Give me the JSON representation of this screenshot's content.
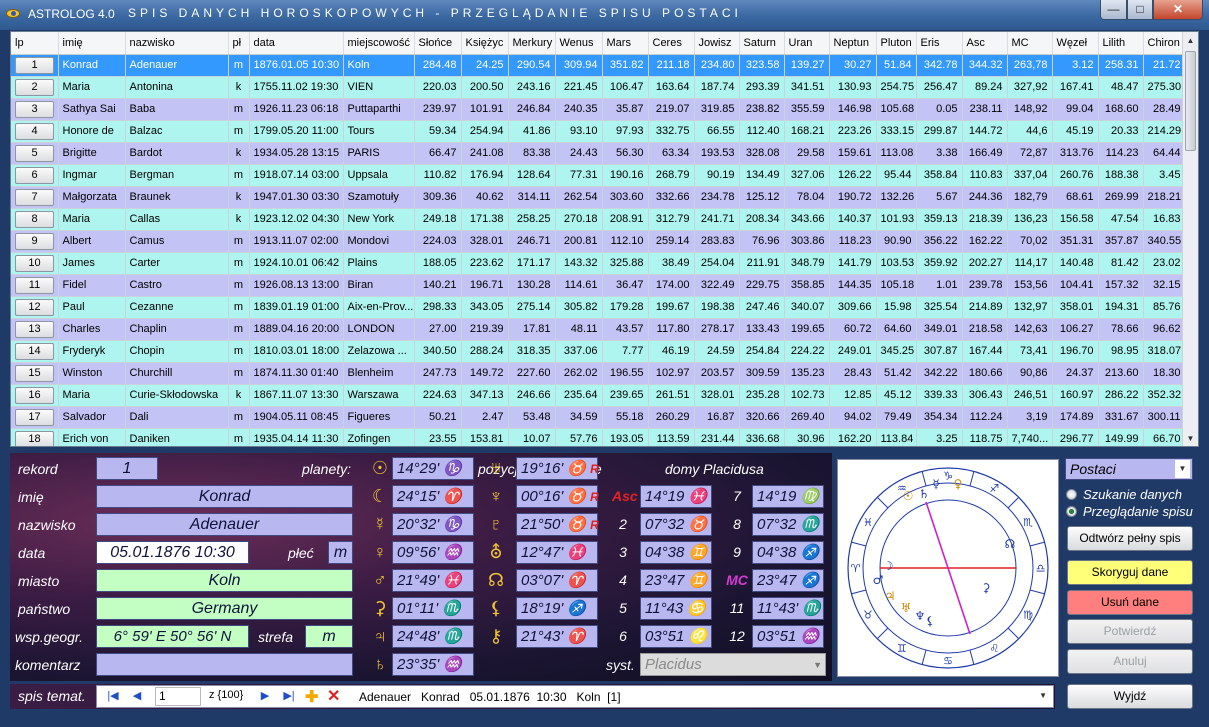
{
  "window": {
    "app_name": "ASTROLOG 4.0",
    "title": "SPIS DANYCH HOROSKOPOWYCH - PRZEGLĄDANIE SPISU  POSTACI",
    "minimize_glyph": "—",
    "maximize_glyph": "□",
    "close_glyph": "✕"
  },
  "table": {
    "columns": [
      "lp",
      "imię",
      "nazwisko",
      "pł",
      "data",
      "miejscowość",
      "Słońce",
      "Księżyc",
      "Merkury",
      "Wenus",
      "Mars",
      "Ceres",
      "Jowisz",
      "Saturn",
      "Uran",
      "Neptun",
      "Pluton",
      "Eris",
      "Asc",
      "MC",
      "Węzeł",
      "Lilith",
      "Chiron"
    ],
    "rows": [
      [
        "1",
        "Konrad",
        "Adenauer",
        "m",
        "1876.01.05 10:30",
        "Koln",
        "284.48",
        "24.25",
        "290.54",
        "309.94",
        "351.82",
        "211.18",
        "234.80",
        "323.58",
        "139.27",
        "30.27",
        "51.84",
        "342.78",
        "344.32",
        "263,78",
        "3.12",
        "258.31",
        "21.72"
      ],
      [
        "2",
        "Maria",
        "Antonina",
        "k",
        "1755.11.02 19:30",
        "VIEN",
        "220.03",
        "200.50",
        "243.16",
        "221.45",
        "106.47",
        "163.64",
        "187.74",
        "293.39",
        "341.51",
        "130.93",
        "254.75",
        "256.47",
        "89.24",
        "327,92",
        "167.41",
        "48.47",
        "275.30"
      ],
      [
        "3",
        "Sathya Sai",
        "Baba",
        "m",
        "1926.11.23 06:18",
        "Puttaparthi",
        "239.97",
        "101.91",
        "246.84",
        "240.35",
        "35.87",
        "219.07",
        "319.85",
        "238.82",
        "355.59",
        "146.98",
        "105.68",
        "0.05",
        "238.11",
        "148,92",
        "99.04",
        "168.60",
        "28.49"
      ],
      [
        "4",
        "Honore de",
        "Balzac",
        "m",
        "1799.05.20 11:00",
        "Tours",
        "59.34",
        "254.94",
        "41.86",
        "93.10",
        "97.93",
        "332.75",
        "66.55",
        "112.40",
        "168.21",
        "223.26",
        "333.15",
        "299.87",
        "144.72",
        "44,6",
        "45.19",
        "20.33",
        "214.29"
      ],
      [
        "5",
        "Brigitte",
        "Bardot",
        "k",
        "1934.05.28 13:15",
        "PARIS",
        "66.47",
        "241.08",
        "83.38",
        "24.43",
        "56.30",
        "63.34",
        "193.53",
        "328.08",
        "29.58",
        "159.61",
        "113.08",
        "3.38",
        "166.49",
        "72,87",
        "313.76",
        "114.23",
        "64.44"
      ],
      [
        "6",
        "Ingmar",
        "Bergman",
        "m",
        "1918.07.14 03:00",
        "Uppsala",
        "110.82",
        "176.94",
        "128.64",
        "77.31",
        "190.16",
        "268.79",
        "90.19",
        "134.49",
        "327.06",
        "126.22",
        "95.44",
        "358.84",
        "110.83",
        "337,04",
        "260.76",
        "188.38",
        "3.45"
      ],
      [
        "7",
        "Małgorzata",
        "Braunek",
        "k",
        "1947.01.30 03:30",
        "Szamotuły",
        "309.36",
        "40.62",
        "314.11",
        "262.54",
        "303.60",
        "332.66",
        "234.78",
        "125.12",
        "78.04",
        "190.72",
        "132.26",
        "5.67",
        "244.36",
        "182,79",
        "68.61",
        "269.99",
        "218.21"
      ],
      [
        "8",
        "Maria",
        "Callas",
        "k",
        "1923.12.02 04:30",
        "New York",
        "249.18",
        "171.38",
        "258.25",
        "270.18",
        "208.91",
        "312.79",
        "241.71",
        "208.34",
        "343.66",
        "140.37",
        "101.93",
        "359.13",
        "218.39",
        "136,23",
        "156.58",
        "47.54",
        "16.83"
      ],
      [
        "9",
        "Albert",
        "Camus",
        "m",
        "1913.11.07 02:00",
        "Mondovi",
        "224.03",
        "328.01",
        "246.71",
        "200.81",
        "112.10",
        "259.14",
        "283.83",
        "76.96",
        "303.86",
        "118.23",
        "90.90",
        "356.22",
        "162.22",
        "70,02",
        "351.31",
        "357.87",
        "340.55"
      ],
      [
        "10",
        "James",
        "Carter",
        "m",
        "1924.10.01 06:42",
        "Plains",
        "188.05",
        "223.62",
        "171.17",
        "143.32",
        "325.88",
        "38.49",
        "254.04",
        "211.91",
        "348.79",
        "141.79",
        "103.53",
        "359.92",
        "202.27",
        "114,17",
        "140.48",
        "81.42",
        "23.02"
      ],
      [
        "11",
        "Fidel",
        "Castro",
        "m",
        "1926.08.13 13:00",
        "Biran",
        "140.21",
        "196.71",
        "130.28",
        "114.61",
        "36.47",
        "174.00",
        "322.49",
        "229.75",
        "358.85",
        "144.35",
        "105.18",
        "1.01",
        "239.78",
        "153,56",
        "104.41",
        "157.32",
        "32.15"
      ],
      [
        "12",
        "Paul",
        "Cezanne",
        "m",
        "1839.01.19 01:00",
        "Aix-en-Prov...",
        "298.33",
        "343.05",
        "275.14",
        "305.82",
        "179.28",
        "199.67",
        "198.38",
        "247.46",
        "340.07",
        "309.66",
        "15.98",
        "325.54",
        "214.89",
        "132,97",
        "358.01",
        "194.31",
        "85.76"
      ],
      [
        "13",
        "Charles",
        "Chaplin",
        "m",
        "1889.04.16 20:00",
        "LONDON",
        "27.00",
        "219.39",
        "17.81",
        "48.11",
        "43.57",
        "117.80",
        "278.17",
        "133.43",
        "199.65",
        "60.72",
        "64.60",
        "349.01",
        "218.58",
        "142,63",
        "106.27",
        "78.66",
        "96.62"
      ],
      [
        "14",
        "Fryderyk",
        "Chopin",
        "m",
        "1810.03.01 18:00",
        "Zelazowa ...",
        "340.50",
        "288.24",
        "318.35",
        "337.06",
        "7.77",
        "46.19",
        "24.59",
        "254.84",
        "224.22",
        "249.01",
        "345.25",
        "307.87",
        "167.44",
        "73,41",
        "196.70",
        "98.95",
        "318.07"
      ],
      [
        "15",
        "Winston",
        "Churchill",
        "m",
        "1874.11.30 01:40",
        "Blenheim",
        "247.73",
        "149.72",
        "227.60",
        "262.02",
        "196.55",
        "102.97",
        "203.57",
        "309.59",
        "135.23",
        "28.43",
        "51.42",
        "342.22",
        "180.66",
        "90,86",
        "24.37",
        "213.60",
        "18.30"
      ],
      [
        "16",
        "Maria",
        "Curie-Skłodowska",
        "k",
        "1867.11.07 13:30",
        "Warszawa",
        "224.63",
        "347.13",
        "246.66",
        "235.64",
        "239.65",
        "261.51",
        "328.01",
        "235.28",
        "102.73",
        "12.85",
        "45.12",
        "339.33",
        "306.43",
        "246,51",
        "160.97",
        "286.22",
        "352.32"
      ],
      [
        "17",
        "Salvador",
        "Dali",
        "m",
        "1904.05.11 08:45",
        "Figueres",
        "50.21",
        "2.47",
        "53.48",
        "34.59",
        "55.18",
        "260.29",
        "16.87",
        "320.66",
        "269.40",
        "94.02",
        "79.49",
        "354.34",
        "112.24",
        "3,19",
        "174.89",
        "331.67",
        "300.11"
      ],
      [
        "18",
        "Erich von",
        "Daniken",
        "m",
        "1935.04.14 11:30",
        "Zofingen",
        "23.55",
        "153.81",
        "10.07",
        "57.76",
        "193.05",
        "113.59",
        "231.44",
        "336.68",
        "30.96",
        "162.20",
        "113.84",
        "3.25",
        "118.75",
        "7,740...",
        "296.77",
        "149.99",
        "66.70"
      ]
    ]
  },
  "record": {
    "labels": {
      "rekord": "rekord",
      "imie": "imię",
      "nazwisko": "nazwisko",
      "data": "data",
      "plec": "płeć",
      "miasto": "miasto",
      "panstwo": "państwo",
      "wsp": "wsp.geogr.",
      "strefa": "strefa",
      "komentarz": "komentarz"
    },
    "rekord": "1",
    "imie": "Konrad",
    "nazwisko": "Adenauer",
    "data": "05.01.1876  10:30",
    "plec": "m",
    "miasto": "Koln",
    "panstwo": "Germany",
    "wsp": "6° 59' E   50° 56' N",
    "strefa": "m",
    "komentarz": ""
  },
  "planets": {
    "header": "planety",
    "col1": [
      {
        "glyph": "☉",
        "pos": "14°29' ♑"
      },
      {
        "glyph": "☾",
        "pos": "24°15' ♈"
      },
      {
        "glyph": "☿",
        "pos": "20°32' ♑"
      },
      {
        "glyph": "♀",
        "pos": "09°56' ♒"
      },
      {
        "glyph": "♂",
        "pos": "21°49' ♓"
      },
      {
        "glyph": "⚳",
        "pos": "01°11' ♏"
      },
      {
        "glyph": "♃",
        "pos": "24°48' ♏"
      },
      {
        "glyph": "♄",
        "pos": "23°35' ♒"
      }
    ],
    "col2": [
      {
        "glyph": "♅",
        "pos": "19°16' ♉",
        "retro": "R"
      },
      {
        "glyph": "♆",
        "pos": "00°16' ♉",
        "retro": "R"
      },
      {
        "glyph": "♇",
        "pos": "21°50' ♉",
        "retro": "R"
      },
      {
        "glyph": "⛢",
        "pos": "12°47' ♓",
        "retro": ""
      },
      {
        "glyph": "☊",
        "pos": "03°07' ♈",
        "retro": ""
      },
      {
        "glyph": "⚸",
        "pos": "18°19' ♐",
        "retro": ""
      },
      {
        "glyph": "⚷",
        "pos": "21°43' ♈",
        "retro": ""
      }
    ],
    "positions_label": "pozycje rzeczywiste"
  },
  "houses": {
    "header": "domy Placidusa",
    "left": [
      {
        "label": "Asc",
        "pos": "14°19 ♓"
      },
      {
        "label": "2",
        "pos": "07°32 ♉"
      },
      {
        "label": "3",
        "pos": "04°38 ♊"
      },
      {
        "label": "4",
        "pos": "23°47 ♊"
      },
      {
        "label": "5",
        "pos": "11°43 ♋"
      },
      {
        "label": "6",
        "pos": "03°51 ♌"
      }
    ],
    "right": [
      {
        "label": "7",
        "pos": "14°19 ♍"
      },
      {
        "label": "8",
        "pos": "07°32 ♏"
      },
      {
        "label": "9",
        "pos": "04°38 ♐"
      },
      {
        "label": "MC",
        "pos": "23°47 ♐"
      },
      {
        "label": "11",
        "pos": "11°43' ♏"
      },
      {
        "label": "12",
        "pos": "03°51 ♒"
      }
    ],
    "syst_label": "syst.",
    "syst_value": "Placidus"
  },
  "chart_wheel": {
    "signs": [
      "♈",
      "♉",
      "♊",
      "♋",
      "♌",
      "♍",
      "♎",
      "♏",
      "♐",
      "♑",
      "♒",
      "♓"
    ],
    "planet_glyphs": [
      "☉",
      "♄",
      "☿",
      "♀",
      "☽",
      "♂",
      "♃",
      "♆",
      "⚸",
      "♅",
      "⚳",
      "☊"
    ]
  },
  "controls": {
    "mode_combo": "Postaci",
    "radio_search": "Szukanie danych",
    "radio_browse": "Przeglądanie spisu",
    "btn_open": "Odtwórz pełny spis",
    "btn_correct": "Skoryguj dane",
    "btn_delete": "Usuń dane",
    "btn_confirm": "Potwierdź",
    "btn_cancel": "Anuluj",
    "btn_exit": "Wyjdź"
  },
  "navbar": {
    "label": "spis temat.",
    "first": "|◀",
    "prev": "◀",
    "position": "1",
    "count": "z {100}",
    "next": "▶",
    "last": "▶|",
    "add": "✚",
    "del": "✕",
    "record_text": "Adenauer   Konrad   05.01.1876  10:30   Koln  [1]"
  },
  "colors": {
    "selected_row": "#3399ff",
    "row_cyan": "#aef5ef",
    "row_lavender": "#c3c4f5",
    "accent_red": "#e0232a",
    "glyph_gold": "#f0c330"
  }
}
